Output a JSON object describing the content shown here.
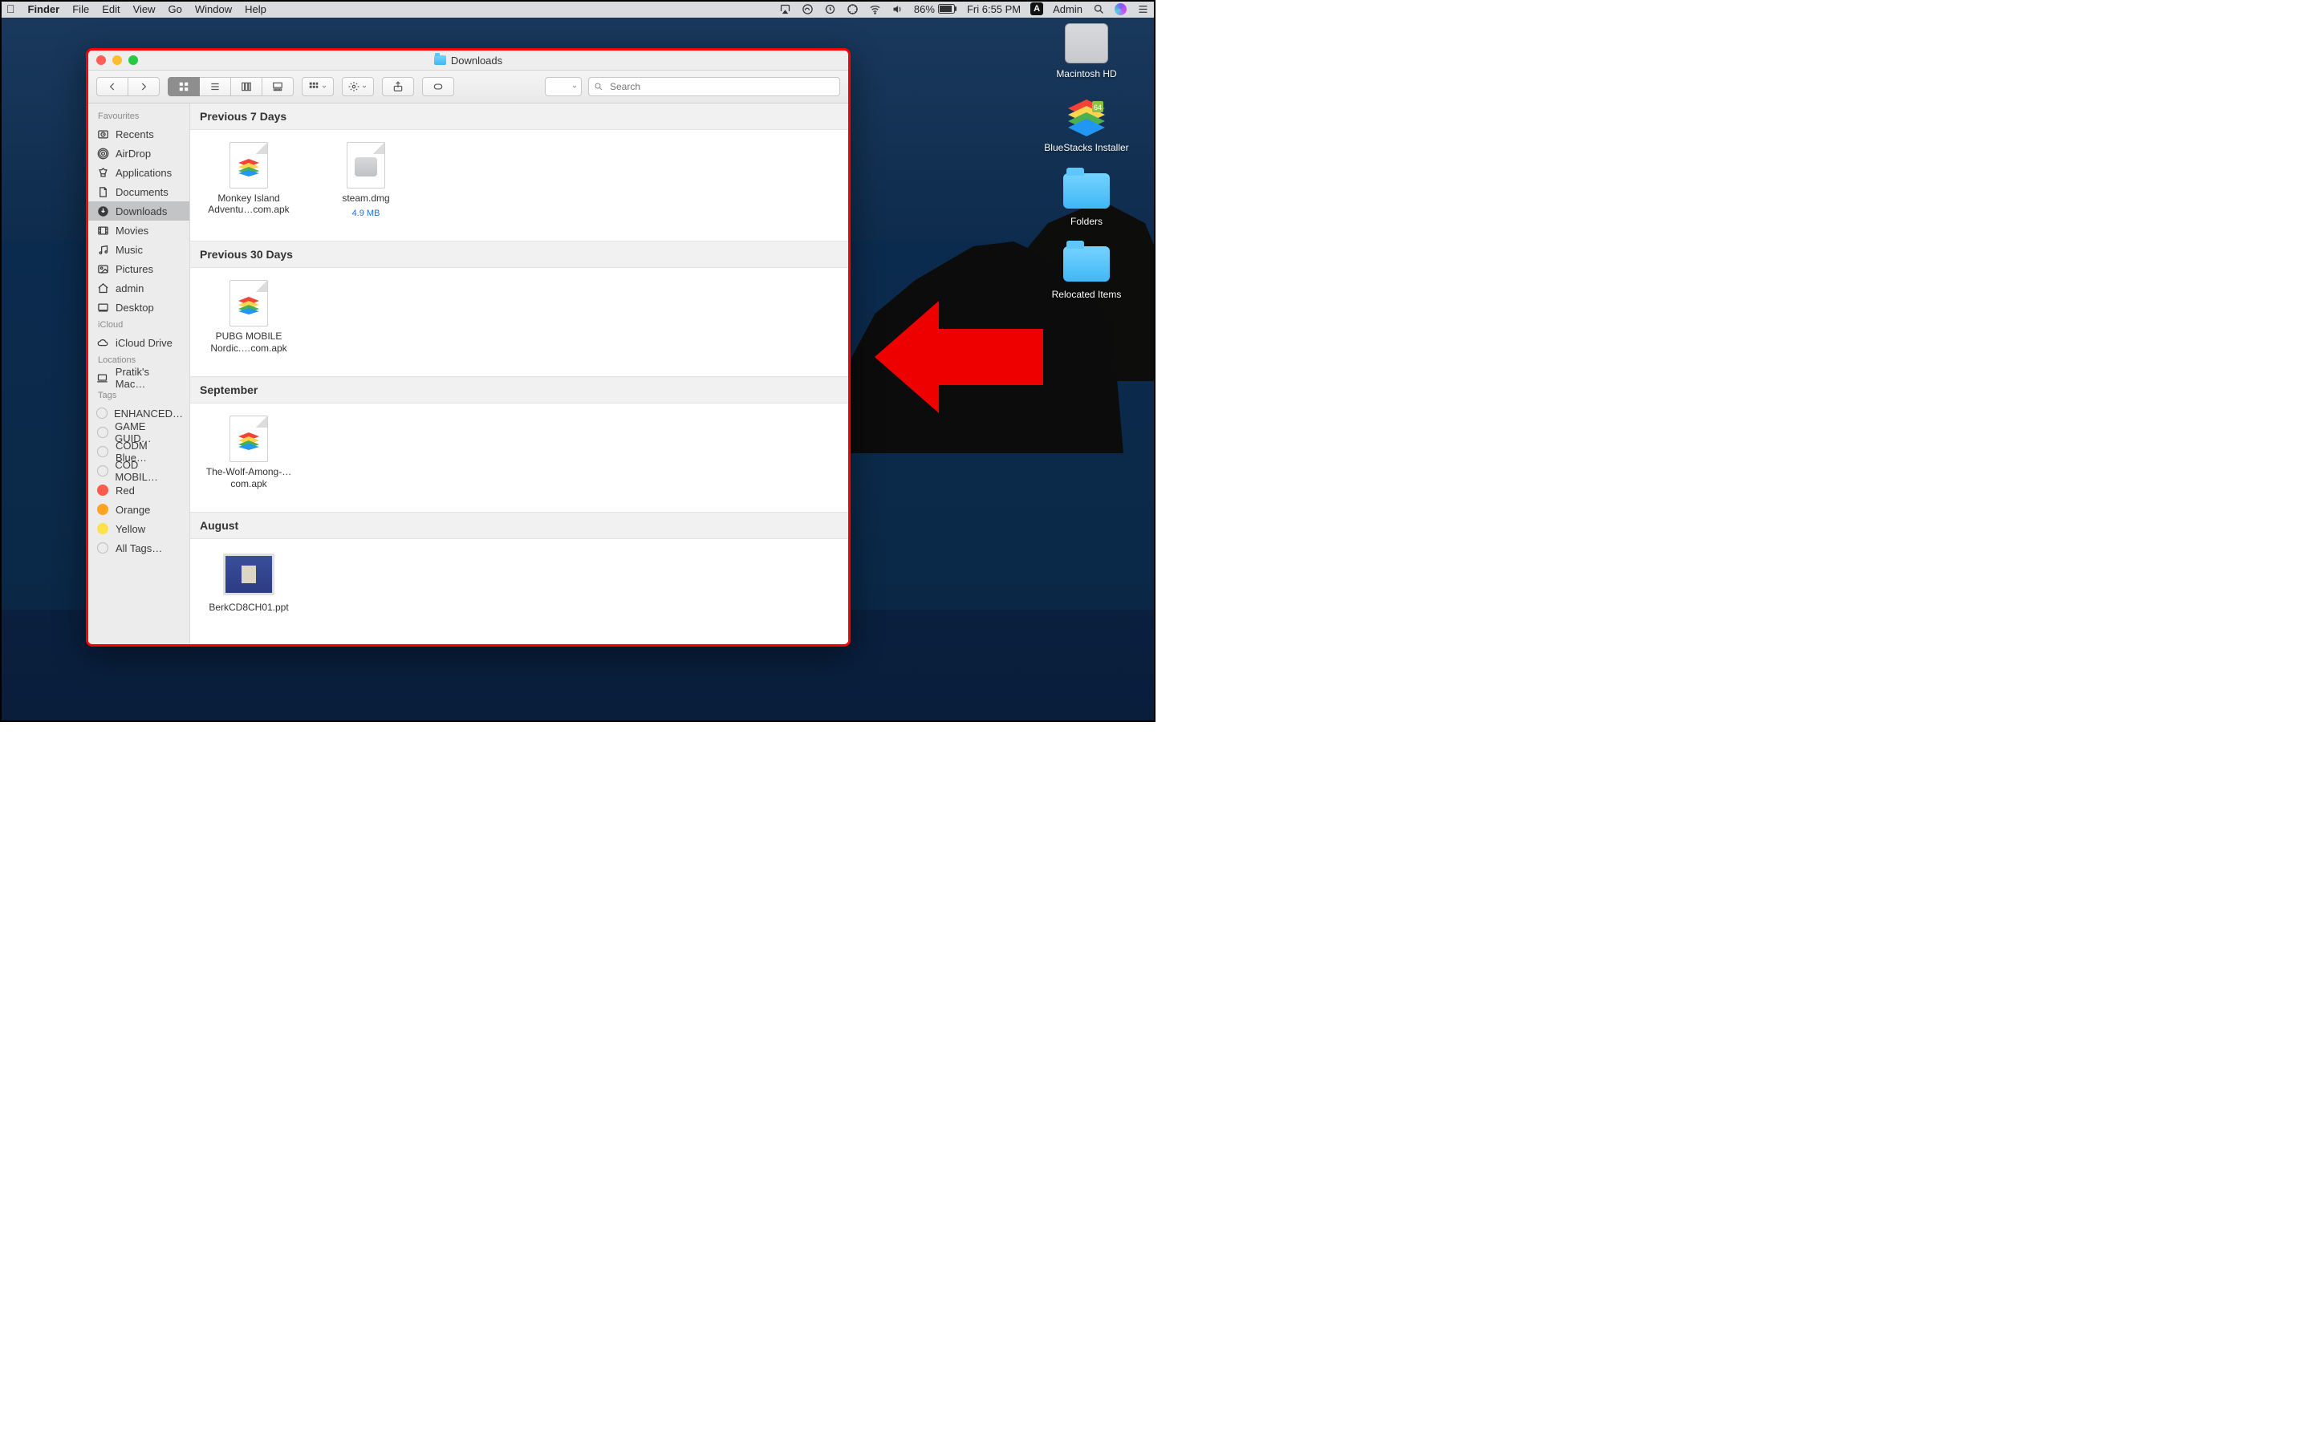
{
  "menubar": {
    "app": "Finder",
    "menus": [
      "File",
      "Edit",
      "View",
      "Go",
      "Window",
      "Help"
    ],
    "battery_pct": "86%",
    "clock": "Fri 6:55 PM",
    "user": "Admin"
  },
  "desktop_icons": [
    {
      "id": "macintosh-hd",
      "label": "Macintosh HD",
      "type": "hd"
    },
    {
      "id": "bluestacks-installer",
      "label": "BlueStacks Installer",
      "type": "bluestacks"
    },
    {
      "id": "folders",
      "label": "Folders",
      "type": "folder"
    },
    {
      "id": "relocated-items",
      "label": "Relocated Items",
      "type": "folder"
    }
  ],
  "finder": {
    "title": "Downloads",
    "search_placeholder": "Search",
    "sidebar": {
      "sections": [
        {
          "heading": "Favourites",
          "items": [
            {
              "name": "Recents",
              "icon": "clock"
            },
            {
              "name": "AirDrop",
              "icon": "airdrop"
            },
            {
              "name": "Applications",
              "icon": "apps"
            },
            {
              "name": "Documents",
              "icon": "doc"
            },
            {
              "name": "Downloads",
              "icon": "download",
              "active": true
            },
            {
              "name": "Movies",
              "icon": "movie"
            },
            {
              "name": "Music",
              "icon": "music"
            },
            {
              "name": "Pictures",
              "icon": "picture"
            },
            {
              "name": "admin",
              "icon": "home"
            },
            {
              "name": "Desktop",
              "icon": "desktop"
            }
          ]
        },
        {
          "heading": "iCloud",
          "items": [
            {
              "name": "iCloud Drive",
              "icon": "cloud"
            }
          ]
        },
        {
          "heading": "Locations",
          "items": [
            {
              "name": "Pratik's Mac…",
              "icon": "laptop"
            }
          ]
        },
        {
          "heading": "Tags",
          "items": [
            {
              "name": "ENHANCED…",
              "icon": "tag"
            },
            {
              "name": "GAME GUID…",
              "icon": "tag"
            },
            {
              "name": "CODM Blue…",
              "icon": "tag"
            },
            {
              "name": "COD MOBIL…",
              "icon": "tag"
            },
            {
              "name": "Red",
              "icon": "tag",
              "color": "red"
            },
            {
              "name": "Orange",
              "icon": "tag",
              "color": "orange"
            },
            {
              "name": "Yellow",
              "icon": "tag",
              "color": "yellow"
            },
            {
              "name": "All Tags…",
              "icon": "tag"
            }
          ]
        }
      ]
    },
    "content": {
      "groups": [
        {
          "heading": "Previous 7 Days",
          "files": [
            {
              "name": "Monkey Island Adventu…com.apk",
              "kind": "bluestacks"
            },
            {
              "name": "steam.dmg",
              "kind": "dmg",
              "meta": "4.9 MB"
            }
          ]
        },
        {
          "heading": "Previous 30 Days",
          "files": [
            {
              "name": "PUBG MOBILE Nordic.…com.apk",
              "kind": "bluestacks"
            }
          ]
        },
        {
          "heading": "September",
          "files": [
            {
              "name": "The-Wolf-Among-…com.apk",
              "kind": "bluestacks"
            }
          ]
        },
        {
          "heading": "August",
          "files": [
            {
              "name": "BerkCD8CH01.ppt",
              "kind": "ppt"
            }
          ]
        }
      ]
    }
  }
}
